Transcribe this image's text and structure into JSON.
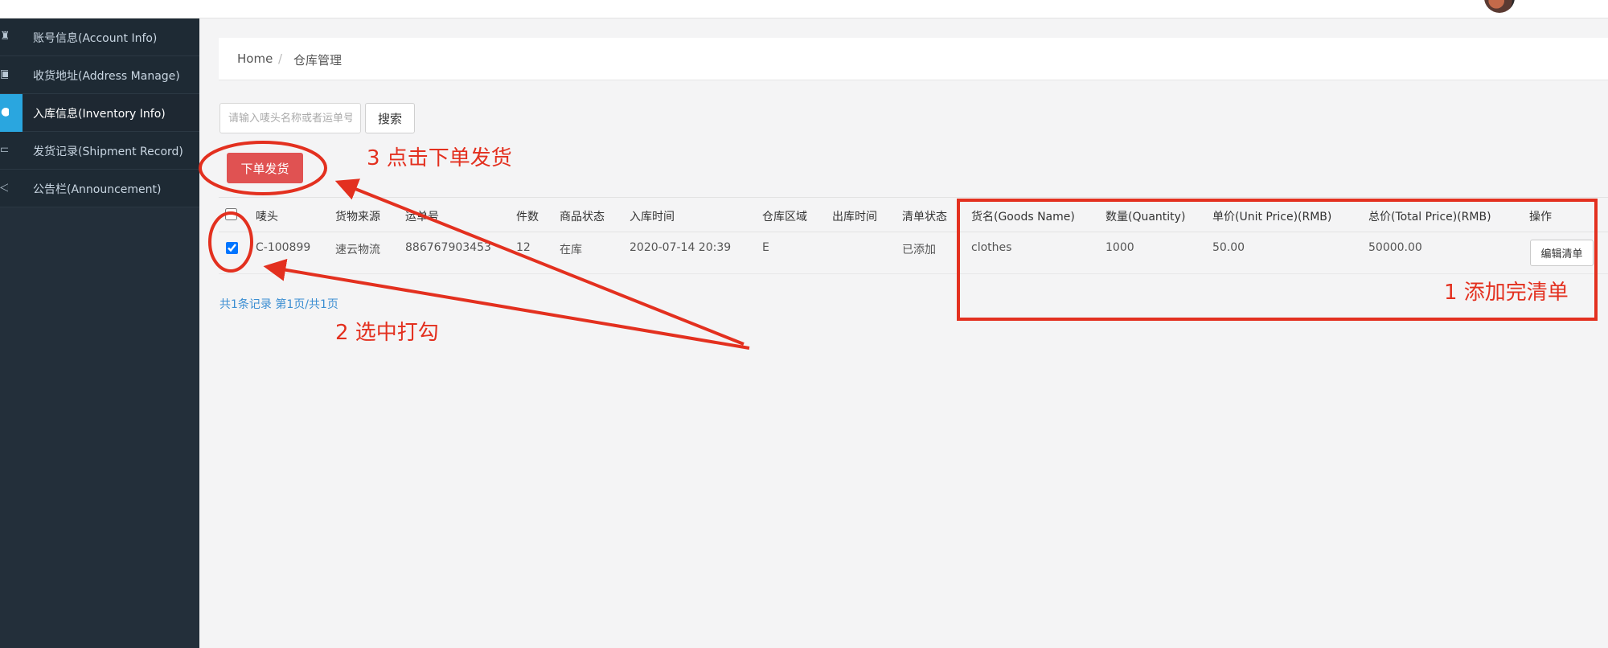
{
  "sidebar": {
    "items": [
      {
        "label": "账号信息(Account Info)",
        "icon": "user-icon"
      },
      {
        "label": "收货地址(Address Manage)",
        "icon": "address-card-icon"
      },
      {
        "label": "入库信息(Inventory Info)",
        "icon": "check-circle-icon",
        "active": true
      },
      {
        "label": "发货记录(Shipment Record)",
        "icon": "monitor-icon"
      },
      {
        "label": "公告栏(Announcement)",
        "icon": "megaphone-icon"
      }
    ]
  },
  "breadcrumb": {
    "home": "Home",
    "separator": "/",
    "current": "仓库管理"
  },
  "search": {
    "placeholder": "请输入唛头名称或者运单号",
    "button_label": "搜索"
  },
  "order_button_label": "下单发货",
  "table": {
    "headers": [
      "唛头",
      "货物来源",
      "运单号",
      "件数",
      "商品状态",
      "入库时间",
      "仓库区域",
      "出库时间",
      "清单状态",
      "货名(Goods Name)",
      "数量(Quantity)",
      "单价(Unit Price)(RMB)",
      "总价(Total Price)(RMB)",
      "操作"
    ],
    "rows": [
      {
        "checked": true,
        "cells": [
          "C-100899",
          "速云物流",
          "886767903453",
          "12",
          "在库",
          "2020-07-14 20:39",
          "E",
          "",
          "已添加",
          "clothes",
          "1000",
          "50.00",
          "50000.00"
        ],
        "action_label": "编辑清单"
      }
    ]
  },
  "pagination": "共1条记录 第1页/共1页",
  "annotations": {
    "step1": "1 添加完清单",
    "step2": "2 选中打勾",
    "step3": "3 点击下单发货",
    "color": "#e3301f"
  },
  "colors": {
    "sidebar": "#232f3a",
    "accent": "#2aa6df",
    "primary_button": "#e05252",
    "link": "#3b8ed2"
  }
}
